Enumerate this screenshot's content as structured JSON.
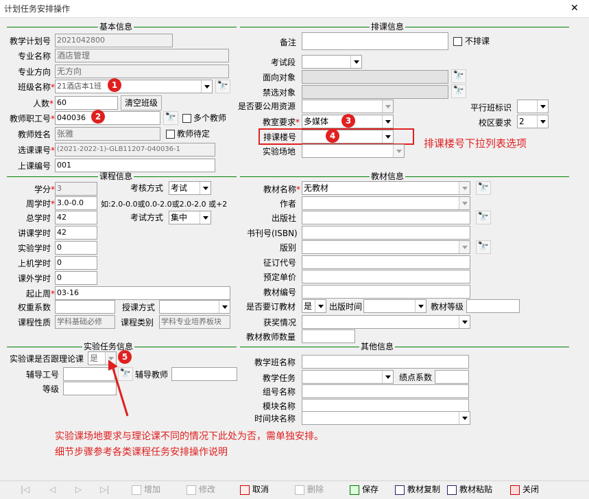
{
  "window": {
    "title": "计划任务安排操作",
    "close": "✕"
  },
  "sections": {
    "basic": "基本信息",
    "schedule": "排课信息",
    "course": "课程信息",
    "textbook": "教材信息",
    "lab": "实验任务信息",
    "other": "其他信息"
  },
  "basic": {
    "plan_no_label": "教学计划号",
    "plan_no": "2021042800",
    "major_label": "专业名称",
    "major": "酒店管理",
    "direction_label": "专业方向",
    "direction": "无方向",
    "class_label": "班级名称",
    "class": "21酒店本1班",
    "count_label": "人数",
    "count": "60",
    "clear_btn": "清空班级",
    "teacher_id_label": "教师职工号",
    "teacher_id": "040036",
    "multi_teacher": "多个教师",
    "teacher_name_label": "教师姓名",
    "teacher_name": "张雅",
    "teacher_pending": "教师待定",
    "course_no_label": "选课课号",
    "course_no": "(2021-2022-1)-GLB11207-040036-1",
    "class_no_label": "上课编号",
    "class_no": "001"
  },
  "schedule": {
    "remark_label": "备注",
    "no_schedule": "不排课",
    "exam_seg_label": "考试段",
    "face_label": "面向对象",
    "ban_label": "禁选对象",
    "public_res_label": "是否要公用资源",
    "parallel_label": "平行班标识",
    "room_req_label": "教室要求",
    "room_req": "多媒体",
    "campus_label": "校区要求",
    "campus": "2",
    "building_label": "排课楼号",
    "lab_site_label": "实验场地"
  },
  "course": {
    "credit_label": "学分",
    "credit": "3",
    "assess_label": "考核方式",
    "assess": "考试",
    "week_hours_label": "周学时",
    "week_hours": "3.0-0.0",
    "week_hint": "如:2.0-0.0或0.0-2.0或2.0-2.0 或+2",
    "total_label": "总学时",
    "total": "42",
    "exam_mode_label": "考试方式",
    "exam_mode": "集中",
    "lecture_label": "讲课学时",
    "lecture": "42",
    "lab_label": "实验学时",
    "lab": "0",
    "computer_label": "上机学时",
    "computer": "0",
    "extra_label": "课外学时",
    "extra": "0",
    "weeks_label": "起止周",
    "weeks": "03-16",
    "weight_label": "权重系数",
    "teach_mode_label": "授课方式",
    "nature_label": "课程性质",
    "nature": "学科基础必修",
    "category_label": "课程类别",
    "category": "学科专业培养板块"
  },
  "textbook": {
    "name_label": "教材名称",
    "name": "无教材",
    "author_label": "作者",
    "publisher_label": "出版社",
    "isbn_label": "书刊号(ISBN)",
    "edition_label": "版别",
    "order_code_label": "征订代号",
    "price_label": "预定单价",
    "code_label": "教材编号",
    "subscribe_label": "是否要订教材",
    "subscribe": "是",
    "pub_time_label": "出版时间",
    "level_label": "教材等级",
    "award_label": "获奖情况",
    "teacher_qty_label": "教材教师数量"
  },
  "lab": {
    "follow_label": "实验课是否跟理论课",
    "follow": "是",
    "tutor_id_label": "辅导工号",
    "tutor_label": "辅导教师",
    "grade_label": "等级"
  },
  "other": {
    "class_name_label": "教学班名称",
    "task_label": "教学任务",
    "gpa_label": "绩点系数",
    "group_label": "组号名称",
    "module_label": "模块名称",
    "time_label": "时间块名称"
  },
  "annotations": {
    "b1": "1",
    "b2": "2",
    "b3": "3",
    "b4": "4",
    "b5": "5",
    "building_note": "排课楼号下拉列表选项",
    "lab_note1": "实验课场地要求与理论课不同的情况下此处为否，需单独安排。",
    "lab_note2": "细节步骤参考各类课程任务安排操作说明"
  },
  "toolbar": {
    "first": "|◁",
    "prev": "◁",
    "next": "▷",
    "last": "▷|",
    "add": "增加",
    "edit": "修改",
    "cancel": "取消",
    "delete": "删除",
    "save": "保存",
    "copy_tb": "教材复制",
    "paste_tb": "教材粘贴",
    "close": "关闭"
  }
}
